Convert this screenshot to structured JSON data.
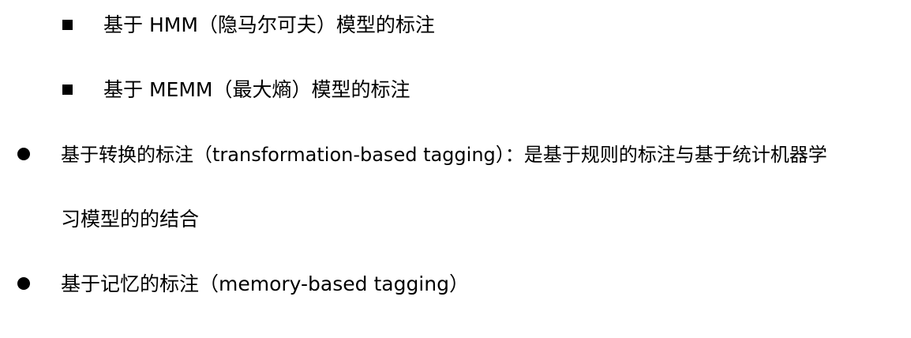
{
  "items": [
    {
      "text": "基于 HMM（隐马尔可夫）模型的标注"
    },
    {
      "text": "基于 MEMM（最大熵）模型的标注"
    },
    {
      "text": "基于转换的标注（transformation-based tagging）：是基于规则的标注与基于统计机器学",
      "continuation": "习模型的的结合"
    },
    {
      "text": "基于记忆的标注（memory-based tagging）"
    }
  ]
}
